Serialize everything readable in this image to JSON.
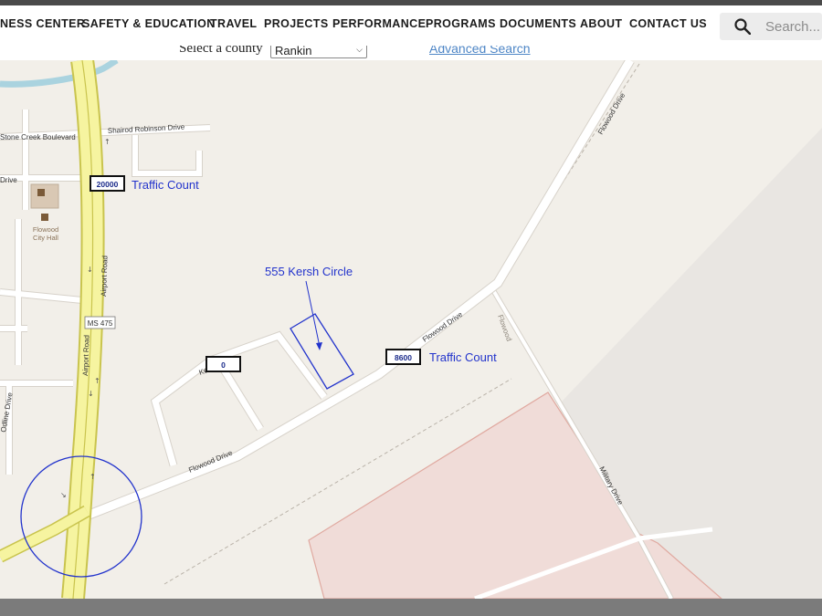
{
  "nav": {
    "items": [
      "NESS CENTER",
      "SAFETY & EDUCATION",
      "TRAVEL",
      "PROJECTS",
      "PERFORMANCE",
      "PROGRAMS",
      "DOCUMENTS",
      "ABOUT",
      "CONTACT US"
    ],
    "search_placeholder": "Search..."
  },
  "county_selector": {
    "label": "Select a county",
    "selected": "Rankin",
    "advanced_search": "Advanced Search"
  },
  "map": {
    "streets": {
      "stone_creek": "Stone Creek Boulevard",
      "shairod": "Shairod Robinson Drive",
      "drive_left": "Drive",
      "airport_upper": "Airport Road",
      "airport_lower": "Airport Road",
      "route": "MS 475",
      "flowood_drive_upper": "Flowood Drive",
      "flowood_drive_mid": "Flowood Drive",
      "flowood_drive_lower": "Flowood Drive",
      "flowood_rail": "Flowood",
      "military": "Military Drive",
      "kersh": "Ke",
      "odline": "Odline Drive"
    },
    "poi": {
      "city_hall_line1": "Flowood",
      "city_hall_line2": "City Hall"
    },
    "annotations": {
      "traffic_count_1_value": "20000",
      "traffic_count_1_label": "Traffic Count",
      "traffic_count_2_value": "8600",
      "traffic_count_2_label": "Traffic Count",
      "kersh_count_value": "0",
      "site_label": "555 Kersh Circle"
    },
    "colors": {
      "land": "#f2efe9",
      "highway": "#f6f4a0",
      "highway_edge": "#c9c44e",
      "road": "#ffffff",
      "road_edge": "#d7d2ca",
      "annotation": "#2233cc",
      "industrial_fill": "#f0dcd8",
      "industrial_edge": "#e0a9a0",
      "water": "#aad3df"
    }
  }
}
